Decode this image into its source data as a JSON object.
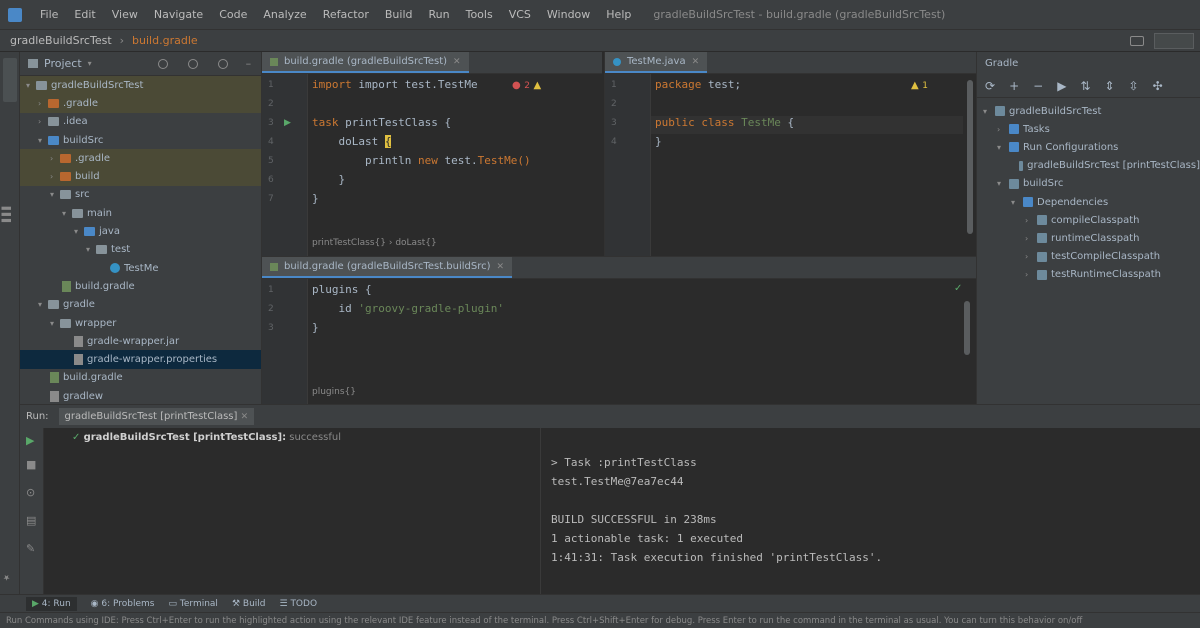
{
  "menubar": {
    "items": [
      "File",
      "Edit",
      "View",
      "Navigate",
      "Code",
      "Analyze",
      "Refactor",
      "Build",
      "Run",
      "Tools",
      "VCS",
      "Window",
      "Help"
    ],
    "window_title": "gradleBuildSrcTest - build.gradle (gradleBuildSrcTest)"
  },
  "navbar": {
    "project": "gradleBuildSrcTest",
    "file": "build.gradle"
  },
  "project_panel": {
    "title": "Project",
    "tree": [
      {
        "label": "gradleBuildSrcTest",
        "depth": 0,
        "arrow": "▾",
        "icon": "folder",
        "style": "hl"
      },
      {
        "label": ".gradle",
        "depth": 1,
        "arrow": "›",
        "icon": "folder-orange",
        "style": "hl"
      },
      {
        "label": ".idea",
        "depth": 1,
        "arrow": "›",
        "icon": "folder",
        "style": ""
      },
      {
        "label": "buildSrc",
        "depth": 1,
        "arrow": "▾",
        "icon": "folder-blue",
        "style": ""
      },
      {
        "label": ".gradle",
        "depth": 2,
        "arrow": "›",
        "icon": "folder-orange",
        "style": "hl"
      },
      {
        "label": "build",
        "depth": 2,
        "arrow": "›",
        "icon": "folder-orange",
        "style": "hl"
      },
      {
        "label": "src",
        "depth": 2,
        "arrow": "▾",
        "icon": "folder",
        "style": ""
      },
      {
        "label": "main",
        "depth": 3,
        "arrow": "▾",
        "icon": "folder",
        "style": ""
      },
      {
        "label": "java",
        "depth": 4,
        "arrow": "▾",
        "icon": "folder-blue",
        "style": ""
      },
      {
        "label": "test",
        "depth": 5,
        "arrow": "▾",
        "icon": "folder",
        "style": ""
      },
      {
        "label": "TestMe",
        "depth": 6,
        "arrow": "",
        "icon": "class",
        "style": ""
      },
      {
        "label": "build.gradle",
        "depth": 2,
        "arrow": "",
        "icon": "file",
        "style": ""
      },
      {
        "label": "gradle",
        "depth": 1,
        "arrow": "▾",
        "icon": "folder",
        "style": ""
      },
      {
        "label": "wrapper",
        "depth": 2,
        "arrow": "▾",
        "icon": "folder",
        "style": ""
      },
      {
        "label": "gradle-wrapper.jar",
        "depth": 3,
        "arrow": "",
        "icon": "file-props",
        "style": ""
      },
      {
        "label": "gradle-wrapper.properties",
        "depth": 3,
        "arrow": "",
        "icon": "file-props",
        "style": "sel"
      },
      {
        "label": "build.gradle",
        "depth": 1,
        "arrow": "",
        "icon": "file",
        "style": ""
      },
      {
        "label": "gradlew",
        "depth": 1,
        "arrow": "",
        "icon": "file-props",
        "style": ""
      }
    ]
  },
  "editor_left": {
    "tab_label": "build.gradle (gradleBuildSrcTest)",
    "line_numbers": [
      "1",
      "2",
      "3",
      "4",
      "5",
      "6",
      "7"
    ],
    "code": {
      "l1": "import test.TestMe",
      "l3_kw": "task ",
      "l3_rest": "printTestClass {",
      "l4": "    doLast ",
      "l5_a": "        println ",
      "l5_kw": "new ",
      "l5_b": "test.",
      "l5_c": "TestMe()",
      "l6": "    }",
      "l7": "}"
    },
    "breadcrumb": "printTestClass{}  ›  doLast{}",
    "inspection": "2"
  },
  "editor_right": {
    "tab_label": "TestMe.java",
    "line_numbers": [
      "1",
      "2",
      "3",
      "4"
    ],
    "code": {
      "l1_kw": "package ",
      "l1_rest": "test;",
      "l3_kw": "public class ",
      "l3_name": "TestMe",
      "l3_rest": " {",
      "l4": "}"
    },
    "inspection": "1"
  },
  "editor_bottom": {
    "tab_label": "build.gradle (gradleBuildSrcTest.buildSrc)",
    "line_numbers": [
      "1",
      "2",
      "3"
    ],
    "code": {
      "l1": "plugins {",
      "l2_a": "    id ",
      "l2_str": "'groovy-gradle-plugin'",
      "l3": "}"
    },
    "breadcrumb": "plugins{}"
  },
  "gradle_panel": {
    "title": "Gradle",
    "tree": [
      {
        "label": "gradleBuildSrcTest",
        "depth": 0,
        "arrow": "▾",
        "icon": "el"
      },
      {
        "label": "Tasks",
        "depth": 1,
        "arrow": "›",
        "icon": "folder"
      },
      {
        "label": "Run Configurations",
        "depth": 1,
        "arrow": "▾",
        "icon": "folder"
      },
      {
        "label": "gradleBuildSrcTest [printTestClass]",
        "depth": 2,
        "arrow": "",
        "icon": "el"
      },
      {
        "label": "buildSrc",
        "depth": 1,
        "arrow": "▾",
        "icon": "el"
      },
      {
        "label": "Dependencies",
        "depth": 2,
        "arrow": "▾",
        "icon": "folder"
      },
      {
        "label": "compileClasspath",
        "depth": 3,
        "arrow": "›",
        "icon": "el"
      },
      {
        "label": "runtimeClasspath",
        "depth": 3,
        "arrow": "›",
        "icon": "el"
      },
      {
        "label": "testCompileClasspath",
        "depth": 3,
        "arrow": "›",
        "icon": "el"
      },
      {
        "label": "testRuntimeClasspath",
        "depth": 3,
        "arrow": "›",
        "icon": "el"
      }
    ]
  },
  "run_panel": {
    "label": "Run:",
    "tab_label": "gradleBuildSrcTest [printTestClass]",
    "tree_label": "gradleBuildSrcTest [printTestClass]:",
    "tree_status": " successful",
    "console": [
      "> Task :printTestClass",
      "test.TestMe@7ea7ec44",
      "",
      "BUILD SUCCESSFUL in 238ms",
      "1 actionable task: 1 executed",
      "1:41:31: Task execution finished 'printTestClass'."
    ]
  },
  "bottom_tabs": [
    "Run",
    "Problems",
    "Terminal",
    "Build",
    "TODO"
  ],
  "status_text": "Run Commands using IDE: Press Ctrl+Enter to run the highlighted action using the relevant IDE feature instead of the terminal. Press Ctrl+Shift+Enter for debug. Press Enter to run the command in the terminal as usual. You can turn this behavior on/off",
  "colors": {
    "background": "#2b2b2b",
    "panel": "#3c3f41",
    "keyword": "#cc7832",
    "string": "#6a8759",
    "selection": "#0d293e",
    "accent": "#4a88c7"
  }
}
